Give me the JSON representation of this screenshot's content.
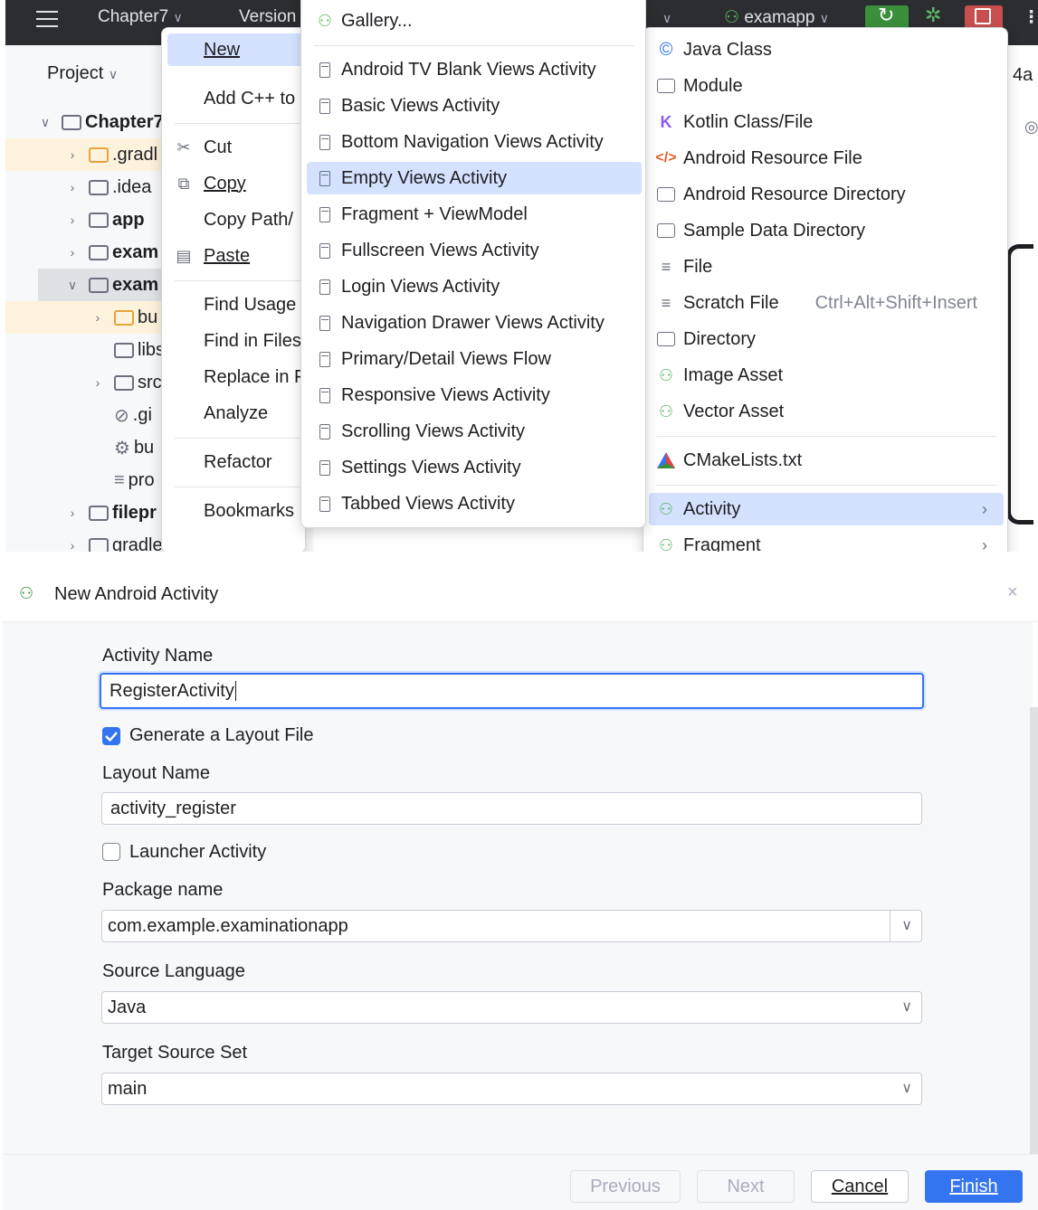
{
  "ide": {
    "title_project": "Chapter7",
    "title_version": "Version",
    "run_config": "examapp",
    "project_label": "Project",
    "tab_hint": "4a",
    "tree": [
      {
        "label": "Chapter7"
      },
      {
        "label": ".gradl"
      },
      {
        "label": ".idea"
      },
      {
        "label": "app"
      },
      {
        "label": "exam"
      },
      {
        "label": "exam"
      },
      {
        "label": "bu"
      },
      {
        "label": "libs"
      },
      {
        "label": "src"
      },
      {
        "label": ".gi"
      },
      {
        "label": "bu"
      },
      {
        "label": "pro"
      },
      {
        "label": "filepr"
      },
      {
        "label": "gradle"
      }
    ]
  },
  "menu1": {
    "items": [
      {
        "label": "New"
      },
      {
        "label": "Add C++ to"
      },
      {
        "label": "Cut"
      },
      {
        "label": "Copy"
      },
      {
        "label": "Copy Path/"
      },
      {
        "label": "Paste"
      },
      {
        "label": "Find Usage"
      },
      {
        "label": "Find in Files"
      },
      {
        "label": "Replace in F"
      },
      {
        "label": "Analyze"
      },
      {
        "label": "Refactor"
      },
      {
        "label": "Bookmarks"
      }
    ]
  },
  "menu2": {
    "items": [
      {
        "label": "Gallery..."
      },
      {
        "label": "Android TV Blank Views Activity"
      },
      {
        "label": "Basic Views Activity"
      },
      {
        "label": "Bottom Navigation Views Activity"
      },
      {
        "label": "Empty Views Activity"
      },
      {
        "label": "Fragment + ViewModel"
      },
      {
        "label": "Fullscreen Views Activity"
      },
      {
        "label": "Login Views Activity"
      },
      {
        "label": "Navigation Drawer Views Activity"
      },
      {
        "label": "Primary/Detail Views Flow"
      },
      {
        "label": "Responsive Views Activity"
      },
      {
        "label": "Scrolling Views Activity"
      },
      {
        "label": "Settings Views Activity"
      },
      {
        "label": "Tabbed Views Activity"
      }
    ]
  },
  "menu3": {
    "items": [
      {
        "label": "Java Class"
      },
      {
        "label": "Module"
      },
      {
        "label": "Kotlin Class/File"
      },
      {
        "label": "Android Resource File"
      },
      {
        "label": "Android Resource Directory"
      },
      {
        "label": "Sample Data Directory"
      },
      {
        "label": "File"
      },
      {
        "label": "Scratch File",
        "shortcut": "Ctrl+Alt+Shift+Insert"
      },
      {
        "label": "Directory"
      },
      {
        "label": "Image Asset"
      },
      {
        "label": "Vector Asset"
      },
      {
        "label": "CMakeLists.txt"
      },
      {
        "label": "Activity"
      },
      {
        "label": "Fragment"
      }
    ]
  },
  "dialog": {
    "title": "New Android Activity",
    "activity_name_label": "Activity Name",
    "activity_name_value": "RegisterActivity",
    "generate_layout_label": "Generate a Layout File",
    "generate_layout_checked": true,
    "layout_name_label": "Layout Name",
    "layout_name_value": "activity_register",
    "launcher_label": "Launcher Activity",
    "launcher_checked": false,
    "package_label": "Package name",
    "package_value": "com.example.examinationapp",
    "source_language_label": "Source Language",
    "source_language_value": "Java",
    "target_source_set_label": "Target Source Set",
    "target_source_set_value": "main",
    "buttons": {
      "previous": "Previous",
      "next": "Next",
      "cancel": "Cancel",
      "finish": "Finish"
    }
  },
  "colors": {
    "accent": "#3574f0",
    "titlebar": "#2b2d30",
    "menu_highlight": "#d4e2ff",
    "run_button": "#3b8f3b",
    "stop_button": "#c94f4f"
  }
}
